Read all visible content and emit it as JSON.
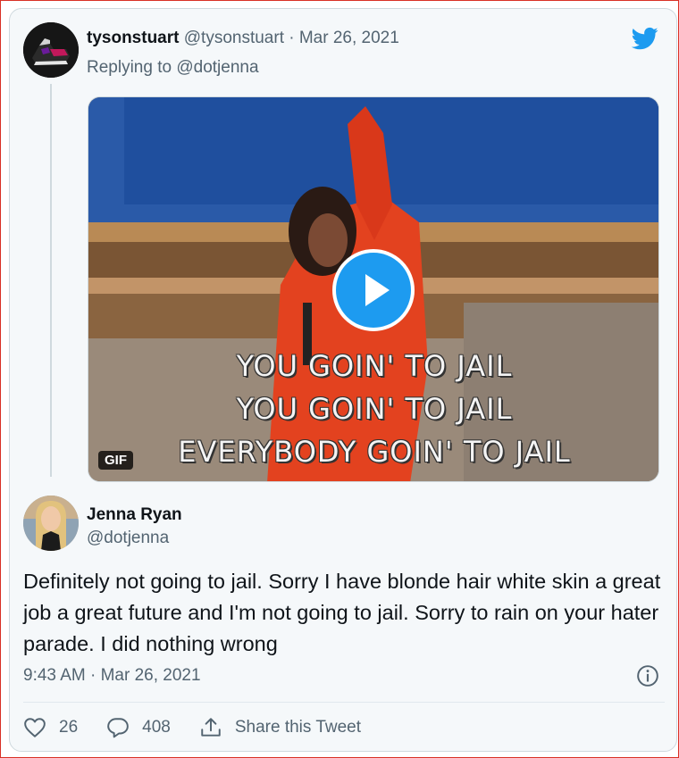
{
  "reply_tweet": {
    "display_name": "tysonstuart",
    "handle": "@tysonstuart",
    "separator": "·",
    "date": "Mar 26, 2021",
    "replying_prefix": "Replying to",
    "replying_handle": "@dotjenna",
    "media": {
      "caption_lines": [
        "YOU GOIN' TO JAIL",
        "YOU GOIN' TO JAIL",
        "EVERYBODY GOIN' TO JAIL"
      ],
      "badge": "GIF"
    }
  },
  "main_tweet": {
    "display_name": "Jenna Ryan",
    "handle": "@dotjenna",
    "text": "Definitely not going to jail. Sorry I have blonde hair white skin a great job a great future and I'm not going to jail. Sorry to rain on your hater parade. I did nothing wrong",
    "timestamp": "9:43 AM · Mar 26, 2021"
  },
  "actions": {
    "likes": "26",
    "replies": "408",
    "share_label": "Share this Tweet"
  },
  "icons": {
    "brand": "twitter-bird-icon",
    "info": "info-icon",
    "like": "heart-icon",
    "reply": "speech-bubble-icon",
    "share": "share-icon"
  },
  "colors": {
    "twitter_blue": "#1d9bf0",
    "muted": "#536471",
    "card_bg": "#f5f8fa"
  }
}
